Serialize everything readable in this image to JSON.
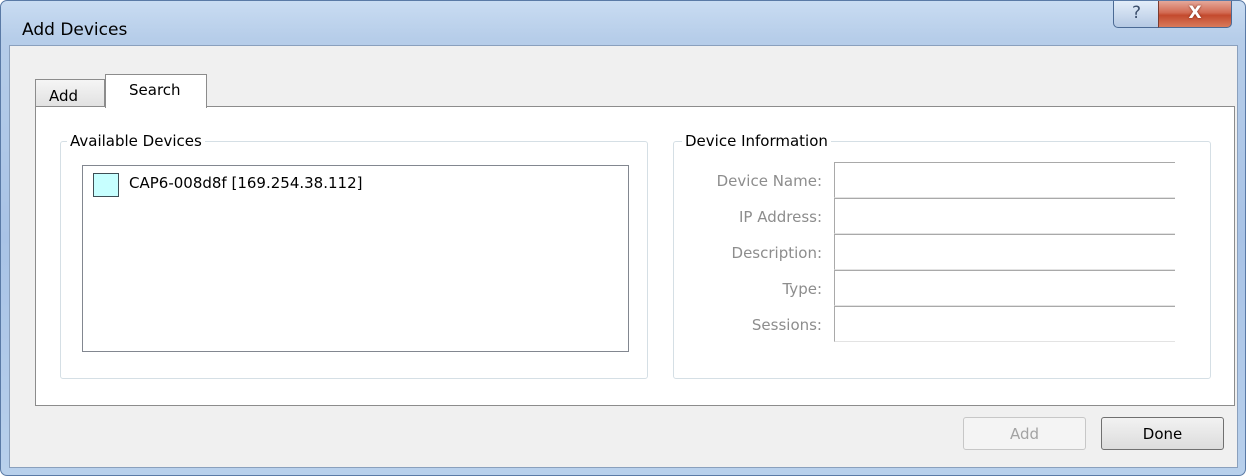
{
  "window": {
    "title": "Add Devices",
    "help_glyph": "?",
    "close_glyph": "X"
  },
  "tabs": [
    {
      "label": "Add",
      "selected": false
    },
    {
      "label": "Search",
      "selected": true
    }
  ],
  "available_devices": {
    "legend": "Available Devices",
    "items": [
      {
        "label": "CAP6-008d8f [169.254.38.112]",
        "icon": "device-status-icon",
        "icon_color": "#c7ffff"
      }
    ]
  },
  "device_information": {
    "legend": "Device Information",
    "fields": [
      {
        "label": "Device Name:",
        "value": ""
      },
      {
        "label": "IP Address:",
        "value": ""
      },
      {
        "label": "Description:",
        "value": ""
      },
      {
        "label": "Type:",
        "value": ""
      },
      {
        "label": "Sessions:",
        "value": ""
      }
    ]
  },
  "buttons": {
    "add_label": "Add",
    "add_enabled": false,
    "done_label": "Done"
  }
}
